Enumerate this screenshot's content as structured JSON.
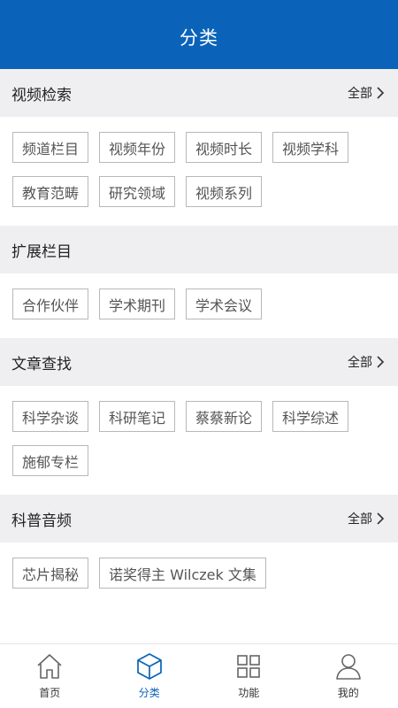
{
  "header": {
    "title": "分类"
  },
  "sections": [
    {
      "title": "视频检索",
      "more": "全部",
      "tags": [
        "频道栏目",
        "视频年份",
        "视频时长",
        "视频学科",
        "教育范畴",
        "研究领域",
        "视频系列"
      ]
    },
    {
      "title": "扩展栏目",
      "more": "",
      "tags": [
        "合作伙伴",
        "学术期刊",
        "学术会议"
      ]
    },
    {
      "title": "文章查找",
      "more": "全部",
      "tags": [
        "科学杂谈",
        "科研笔记",
        "蔡蔡新论",
        "科学综述",
        "施郁专栏"
      ]
    },
    {
      "title": "科普音频",
      "more": "全部",
      "tags": [
        "芯片揭秘",
        "诺奖得主 Wilczek 文集"
      ]
    }
  ],
  "tabbar": {
    "items": [
      {
        "label": "首页",
        "icon": "home-icon"
      },
      {
        "label": "分类",
        "icon": "cube-icon",
        "active": true
      },
      {
        "label": "功能",
        "icon": "grid-icon"
      },
      {
        "label": "我的",
        "icon": "user-icon"
      }
    ]
  },
  "colors": {
    "primary": "#0a63b8",
    "section_bg": "#efeff1",
    "tag_border": "#b8b8b8"
  }
}
